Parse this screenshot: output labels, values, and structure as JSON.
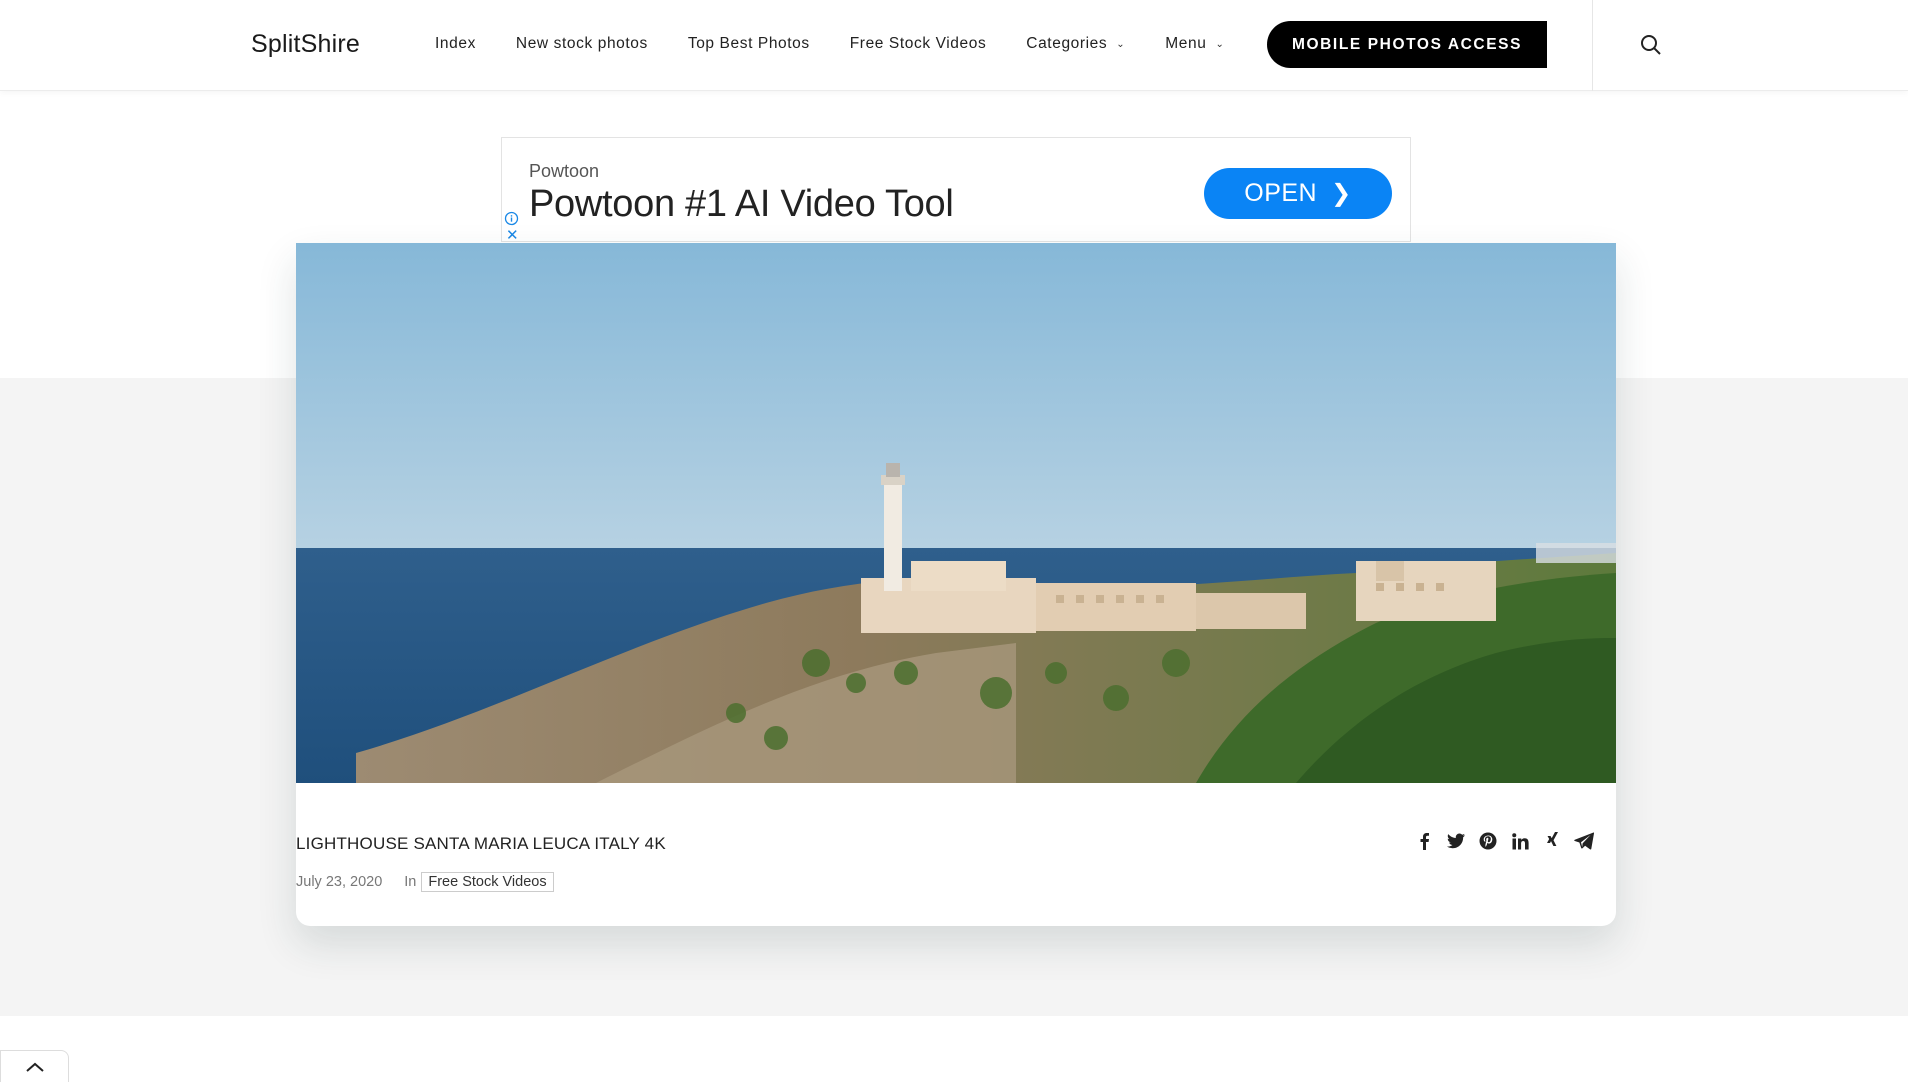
{
  "header": {
    "logo": "SplitShire",
    "nav": [
      {
        "label": "Index",
        "dropdown": false
      },
      {
        "label": "New stock photos",
        "dropdown": false
      },
      {
        "label": "Top Best Photos",
        "dropdown": false
      },
      {
        "label": "Free Stock Videos",
        "dropdown": false
      },
      {
        "label": "Categories",
        "dropdown": true
      },
      {
        "label": "Menu",
        "dropdown": true
      }
    ],
    "cta_label": "MOBILE PHOTOS ACCESS",
    "search_icon": "search-icon"
  },
  "ad": {
    "brand": "Powtoon",
    "title": "Powtoon #1 AI Video Tool",
    "button_label": "OPEN",
    "button_color": "#0a84f5"
  },
  "post": {
    "title": "LIGHTHOUSE SANTA MARIA LEUCA ITALY 4K",
    "date": "July 23, 2020",
    "in_label": "In",
    "category": "Free Stock Videos",
    "share_icons": [
      "facebook-icon",
      "twitter-icon",
      "pinterest-icon",
      "linkedin-icon",
      "xing-icon",
      "telegram-icon"
    ]
  },
  "footer": {
    "back_to_top_icon": "chevron-up-icon"
  }
}
